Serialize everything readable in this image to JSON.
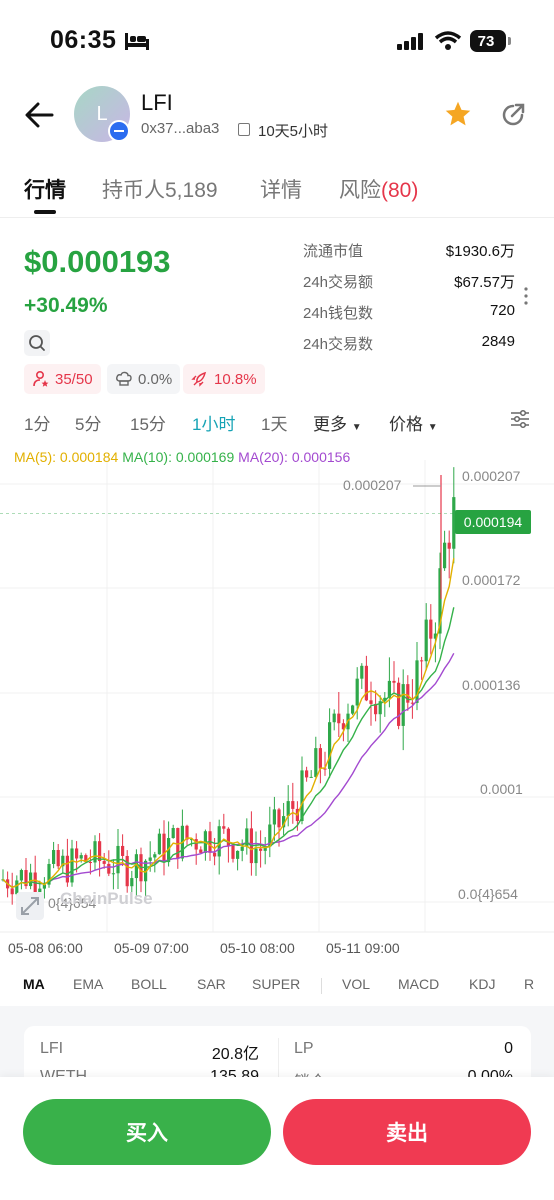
{
  "status_bar": {
    "time": "06:35",
    "battery": "73"
  },
  "header": {
    "avatar_letter": "L",
    "token_name": "LFI",
    "address": "0x37...aba3",
    "age": "10天5小时"
  },
  "tabs": [
    {
      "label": "行情"
    },
    {
      "label": "持币人5,189"
    },
    {
      "label": "详情"
    },
    {
      "label": "风险",
      "count": "(80)"
    }
  ],
  "price": {
    "value": "$0.000193",
    "change": "+30.49%"
  },
  "chips": {
    "holders": "35/50",
    "dev": "0.0%",
    "top": "10.8%"
  },
  "stats": [
    {
      "label": "流通市值",
      "value": "$1930.6万"
    },
    {
      "label": "24h交易额",
      "value": "$67.57万"
    },
    {
      "label": "24h钱包数",
      "value": "720"
    },
    {
      "label": "24h交易数",
      "value": "2849"
    }
  ],
  "intervals": [
    "1分",
    "5分",
    "15分",
    "1小时",
    "1天",
    "更多",
    "价格"
  ],
  "chart": {
    "ma_legend": {
      "ma5": "MA(5): 0.000184",
      "ma10": "MA(10): 0.000169",
      "ma20": "MA(20): 0.000156"
    },
    "y_labels": [
      "0.000207",
      "0.000172",
      "0.000136",
      "0.0001",
      "0.0{4}654"
    ],
    "current_price_tag": "0.000194",
    "max_label": "0.000207",
    "min_label": "0{4}654",
    "watermark": "ChainPulse",
    "x_labels": [
      "05-08 06:00",
      "05-09 07:00",
      "05-10 08:00",
      "05-11 09:00"
    ]
  },
  "chart_data": {
    "type": "candlestick",
    "y_ticks": [
      "0.000207",
      "0.000172",
      "0.000136",
      "0.0001",
      "0.0{4}654"
    ],
    "x_ticks": [
      "05-08 06:00",
      "05-09 07:00",
      "05-10 08:00",
      "05-11 09:00"
    ],
    "current_price": 0.000194,
    "series": [
      {
        "name": "MA(5)",
        "last": 0.000184,
        "color": "#e2b000"
      },
      {
        "name": "MA(10)",
        "last": 0.000169,
        "color": "#35b24a"
      },
      {
        "name": "MA(20)",
        "last": 0.000156,
        "color": "#a34ad0"
      }
    ]
  },
  "indicators": [
    "MA",
    "EMA",
    "BOLL",
    "SAR",
    "SUPER",
    "VOL",
    "MACD",
    "KDJ",
    "R"
  ],
  "pool": {
    "left": [
      {
        "k": "LFI",
        "v": "20.8亿"
      },
      {
        "k": "WETH",
        "v": "135.89"
      }
    ],
    "right": [
      {
        "k": "LP",
        "v": "0"
      },
      {
        "k": "锁仓",
        "v": "0.00%"
      }
    ]
  },
  "actions": {
    "buy": "买入",
    "sell": "卖出"
  }
}
